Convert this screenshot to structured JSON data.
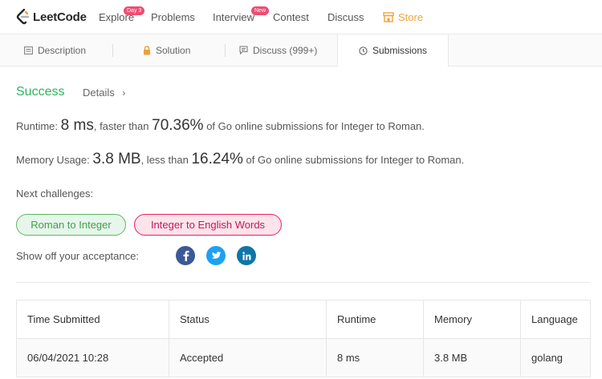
{
  "header": {
    "logo_text": "LeetCode",
    "nav": [
      {
        "label": "Explore",
        "badge": "Day 3"
      },
      {
        "label": "Problems"
      },
      {
        "label": "Interview",
        "badge": "New"
      },
      {
        "label": "Contest"
      },
      {
        "label": "Discuss"
      },
      {
        "label": "Store",
        "icon": "store-icon"
      }
    ]
  },
  "tabs": [
    {
      "label": "Description",
      "icon": "description-icon"
    },
    {
      "label": "Solution",
      "icon": "lock-icon"
    },
    {
      "label": "Discuss (999+)",
      "icon": "discuss-icon"
    },
    {
      "label": "Submissions",
      "icon": "clock-icon",
      "active": true
    }
  ],
  "result": {
    "status": "Success",
    "details_label": "Details",
    "runtime": {
      "label": "Runtime:",
      "value": "8 ms",
      "comparison": ", faster than",
      "percent": "70.36%",
      "suffix": "of Go online submissions for Integer to Roman."
    },
    "memory": {
      "label": "Memory Usage:",
      "value": "3.8 MB",
      "comparison": ", less than",
      "percent": "16.24%",
      "suffix": "of Go online submissions for Integer to Roman."
    },
    "next_label": "Next challenges:",
    "challenges": [
      "Roman to Integer",
      "Integer to English Words"
    ],
    "share_label": "Show off your acceptance:",
    "share_icons": [
      "facebook-icon",
      "twitter-icon",
      "linkedin-icon"
    ]
  },
  "table": {
    "headers": [
      "Time Submitted",
      "Status",
      "Runtime",
      "Memory",
      "Language"
    ],
    "rows": [
      [
        "06/04/2021 10:28",
        "Accepted",
        "8 ms",
        "3.8 MB",
        "golang"
      ]
    ]
  },
  "colors": {
    "success": "#2db55d",
    "store": "#f0a53a",
    "badge": "#ef4c73",
    "facebook": "#3b5998",
    "twitter": "#1da1f2",
    "linkedin": "#0e76a8"
  }
}
